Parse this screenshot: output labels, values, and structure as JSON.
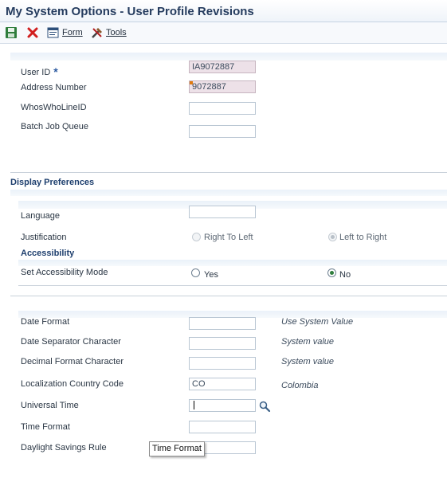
{
  "window": {
    "title": "My System Options - User Profile Revisions"
  },
  "toolbar": {
    "save_icon": "floppy-save-icon",
    "close_icon": "red-x-close-icon",
    "form_label": "Form",
    "tools_label": "Tools"
  },
  "user": {
    "user_id_label": "User ID",
    "user_id_value": "IA9072887",
    "address_label": "Address Number",
    "address_value": "9072887",
    "whoswho_label": "WhosWhoLineID",
    "batch_label": "Batch Job Queue"
  },
  "display": {
    "section_title": "Display Preferences",
    "language_label": "Language",
    "justification_label": "Justification",
    "rtl_label": "Right To Left",
    "ltr_label": "Left to Right"
  },
  "accessibility": {
    "section_title": "Accessibility",
    "mode_label": "Set Accessibility Mode",
    "yes_label": "Yes",
    "no_label": "No"
  },
  "formats": {
    "date_format_label": "Date Format",
    "date_format_note": "Use System Value",
    "date_sep_label": "Date Separator Character",
    "date_sep_note": "System value",
    "decimal_label": "Decimal Format Character",
    "decimal_note": "System value",
    "country_label": "Localization Country Code",
    "country_value": "CO",
    "country_note": "Colombia",
    "universal_time_label": "Universal Time",
    "time_format_label": "Time Format",
    "daylight_label": "Daylight Savings Rule"
  },
  "tooltip": {
    "text": "Time Format"
  },
  "colors": {
    "accent": "#1e3f6e",
    "readonly_bg": "#ede1e8",
    "radio_selected": "#2f7d3c"
  }
}
